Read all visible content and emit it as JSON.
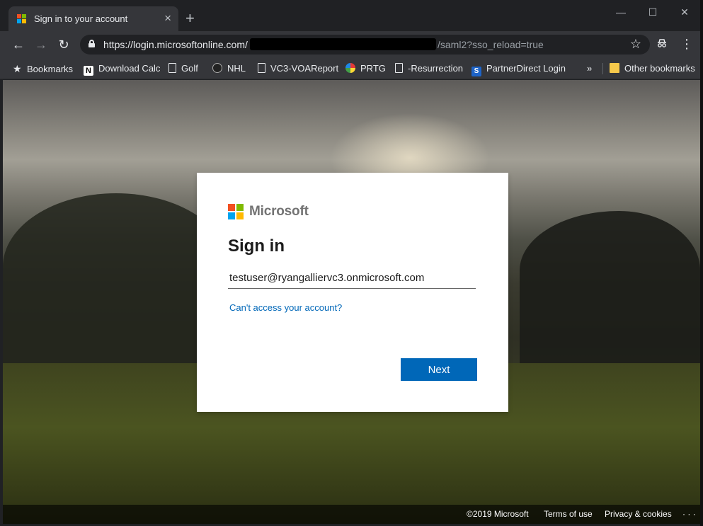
{
  "browser": {
    "tab": {
      "title": "Sign in to your account",
      "close": "×"
    },
    "new_tab": "+",
    "window_controls": {
      "minimize": "—",
      "maximize": "☐",
      "close": "✕"
    },
    "nav": {
      "back": "←",
      "forward": "→",
      "reload": "↻"
    },
    "address": {
      "url_host": "https://login.microsoftonline.com/",
      "url_tail": "/saml2?sso_reload=true"
    },
    "bookmark_star": "☆",
    "menu": "⋮",
    "bookmarks": [
      {
        "label": "Bookmarks",
        "icon": "star-icon"
      },
      {
        "label": "Download Calc",
        "icon": "notion-icon"
      },
      {
        "label": "Golf",
        "icon": "page-icon"
      },
      {
        "label": "NHL",
        "icon": "nhl-icon"
      },
      {
        "label": "VC3-VOAReport",
        "icon": "page-icon"
      },
      {
        "label": "PRTG",
        "icon": "prtg-icon"
      },
      {
        "label": "-Resurrection",
        "icon": "page-icon"
      },
      {
        "label": "PartnerDirect Login",
        "icon": "s-icon"
      }
    ],
    "overflow": "»",
    "other_bookmarks": "Other bookmarks"
  },
  "signin": {
    "brand": "Microsoft",
    "title": "Sign in",
    "email_value": "testuser@ryangalliervc3.onmicrosoft.com",
    "cant_access": "Can't access your account?",
    "next": "Next"
  },
  "footer": {
    "copyright": "©2019 Microsoft",
    "terms": "Terms of use",
    "privacy": "Privacy & cookies",
    "more": "· · ·"
  },
  "colors": {
    "accent": "#0067b8",
    "ms_red": "#f25022",
    "ms_green": "#7fba00",
    "ms_blue": "#00a4ef",
    "ms_yellow": "#ffb900"
  }
}
